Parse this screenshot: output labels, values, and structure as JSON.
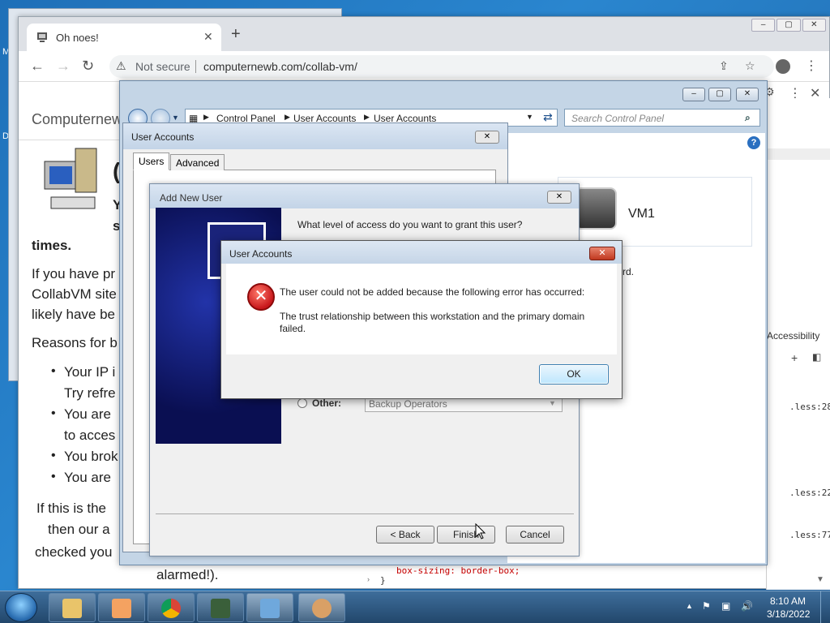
{
  "desktop": {
    "edge_letters": [
      "M",
      "D"
    ]
  },
  "browser": {
    "tab_title": "Oh noes!",
    "not_secure": "Not secure",
    "url": "computernewb.com/collab-vm/",
    "site_name": "Computernew",
    "page_lines": [
      {
        "text": "times.",
        "bold": true
      },
      {
        "text": "If you have pr"
      },
      {
        "text": "CollabVM site"
      },
      {
        "text": "likely have be"
      },
      {
        "text": "Reasons for b"
      }
    ],
    "bullets": [
      "Your IP i",
      "Try refre",
      "You are",
      "to acces",
      "You brok",
      "You are"
    ],
    "tail_lines": [
      "If this is the",
      "then our a",
      "checked you",
      "alarmed!)."
    ],
    "header_fragments": [
      "(",
      "Y",
      "s"
    ]
  },
  "devtools": {
    "accessibility": "Accessibility",
    "refs": [
      ".less:28",
      ".less:22",
      ".less:77"
    ],
    "css_line": "box-sizing: border-box;",
    "brace": "}"
  },
  "control_panel": {
    "breadcrumb": [
      "Control Panel",
      "User Accounts",
      "User Accounts"
    ],
    "search_placeholder": "Search Control Panel",
    "vm_label": "VM1",
    "rd_text": "rd."
  },
  "user_accounts": {
    "title": "User Accounts",
    "tabs": [
      "Users",
      "Advanced"
    ]
  },
  "add_new_user": {
    "title": "Add New User",
    "question": "What level of access do you want to grant this user?",
    "other_label": "Other:",
    "other_value": "Backup Operators",
    "buttons": {
      "back": "< Back",
      "finish": "Finish",
      "cancel": "Cancel"
    }
  },
  "error_dialog": {
    "title": "User Accounts",
    "message": "The user could not be added because the following error has occurred:",
    "detail": "The trust relationship between this workstation and the primary domain failed.",
    "ok": "OK"
  },
  "taskbar": {
    "time": "8:10 AM",
    "date": "3/18/2022"
  }
}
